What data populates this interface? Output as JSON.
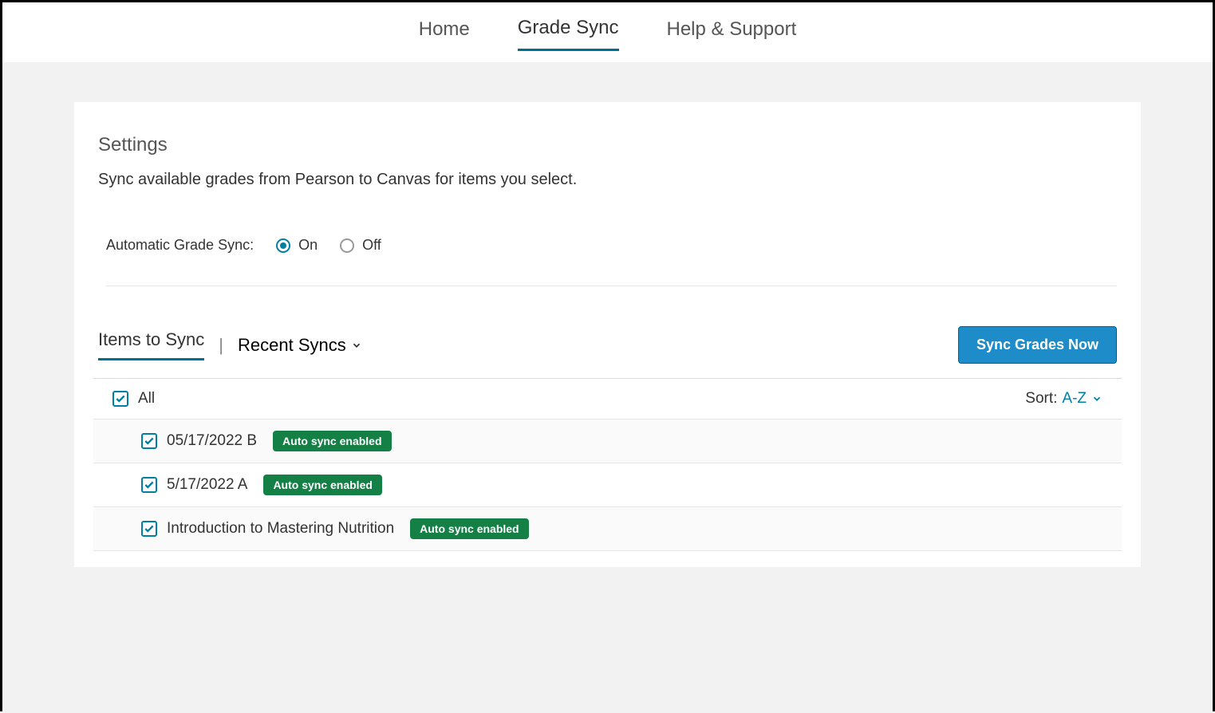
{
  "nav": {
    "items": [
      {
        "label": "Home",
        "active": false
      },
      {
        "label": "Grade Sync",
        "active": true
      },
      {
        "label": "Help & Support",
        "active": false
      }
    ]
  },
  "settings": {
    "title": "Settings",
    "description": "Sync available grades from Pearson to Canvas for items you select.",
    "autoSyncLabel": "Automatic Grade Sync:",
    "onLabel": "On",
    "offLabel": "Off",
    "selected": "on"
  },
  "tabs": {
    "itemsToSync": "Items to Sync",
    "recentSyncs": "Recent Syncs"
  },
  "syncButton": "Sync Grades Now",
  "listHeader": {
    "allLabel": "All",
    "sortLabel": "Sort:",
    "sortValue": "A-Z"
  },
  "items": [
    {
      "label": "05/17/2022 B",
      "badge": "Auto sync enabled",
      "checked": true
    },
    {
      "label": "5/17/2022 A",
      "badge": "Auto sync enabled",
      "checked": true
    },
    {
      "label": "Introduction to Mastering Nutrition",
      "badge": "Auto sync enabled",
      "checked": true
    }
  ]
}
